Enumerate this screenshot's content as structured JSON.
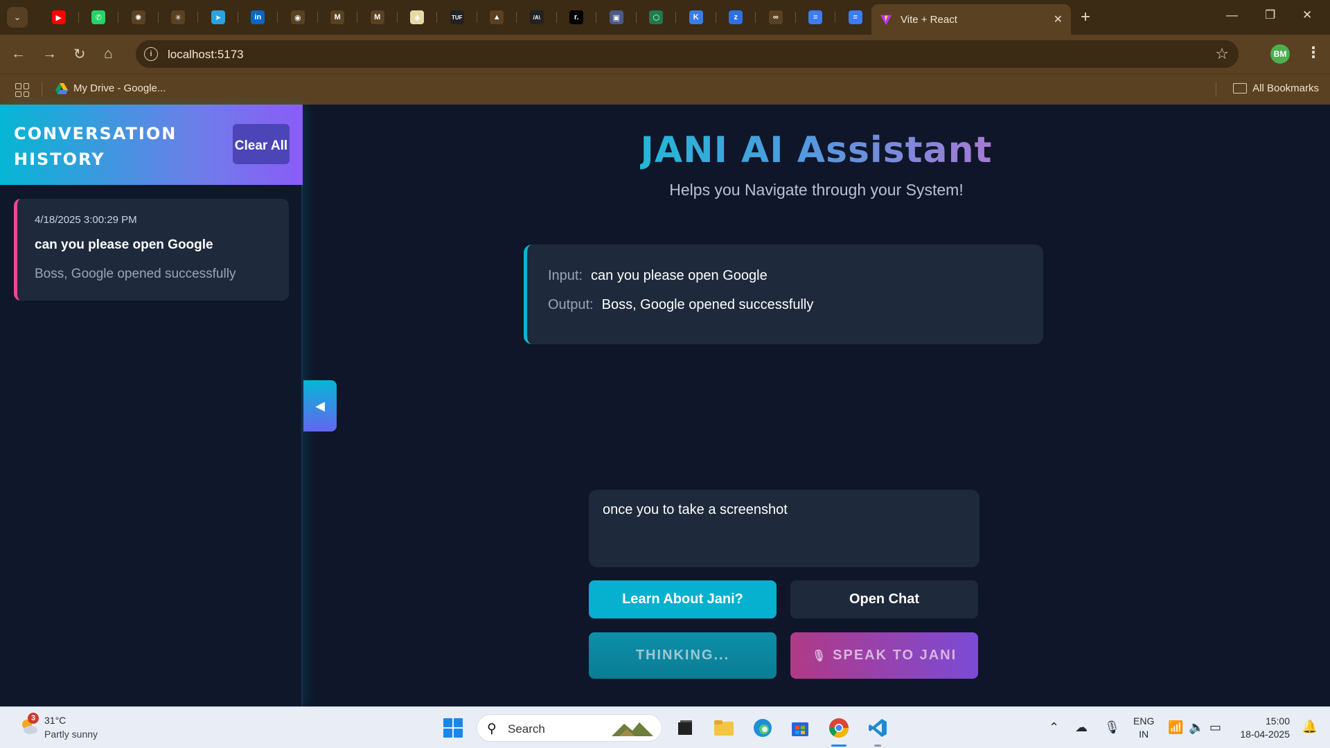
{
  "browser": {
    "active_tab_title": "Vite + React",
    "url": "localhost:5173",
    "profile_initials": "BM",
    "bookmarks": [
      {
        "label": "My Drive - Google..."
      },
      {
        "label": "All Bookmarks"
      }
    ],
    "pinned_tabs": [
      {
        "icon": "youtube-icon",
        "color": "#ff0000",
        "glyph": "▶"
      },
      {
        "icon": "whatsapp-icon",
        "color": "#25d366",
        "glyph": "✆"
      },
      {
        "icon": "chatgpt-icon",
        "color": "#5a4121",
        "glyph": "✺"
      },
      {
        "icon": "claude-icon",
        "color": "#5a4121",
        "glyph": "✳"
      },
      {
        "icon": "telegram-icon",
        "color": "#2aa3df",
        "glyph": "➤"
      },
      {
        "icon": "linkedin-icon",
        "color": "#0a66c2",
        "glyph": "in"
      },
      {
        "icon": "github-icon",
        "color": "#5a4121",
        "glyph": "◉"
      },
      {
        "icon": "gmail-icon",
        "color": "#5a4121",
        "glyph": "M"
      },
      {
        "icon": "gmail-icon",
        "color": "#5a4121",
        "glyph": "M"
      },
      {
        "icon": "college-icon",
        "color": "#e7d9a6",
        "glyph": "◈"
      },
      {
        "icon": "tuf-icon",
        "color": "#222222",
        "glyph": "TUF"
      },
      {
        "icon": "rocket-icon",
        "color": "#5a4121",
        "glyph": "▲"
      },
      {
        "icon": "dev-icon",
        "color": "#222222",
        "glyph": "/A\\"
      },
      {
        "icon": "replit-icon",
        "color": "#000000",
        "glyph": "r."
      },
      {
        "icon": "photos-icon",
        "color": "#4a5a8a",
        "glyph": "▣"
      },
      {
        "icon": "perplexity-icon",
        "color": "#1f7a4d",
        "glyph": "⬡"
      },
      {
        "icon": "kotlin-icon",
        "color": "#3b7de8",
        "glyph": "K"
      },
      {
        "icon": "zbook-icon",
        "color": "#2f6fe4",
        "glyph": "z"
      },
      {
        "icon": "infinity-icon",
        "color": "#5a4121",
        "glyph": "∞"
      },
      {
        "icon": "docs-icon",
        "color": "#3d7cf2",
        "glyph": "≡"
      },
      {
        "icon": "docs-icon",
        "color": "#3d7cf2",
        "glyph": "≡"
      }
    ]
  },
  "sidebar": {
    "title": "CONVERSATION HISTORY",
    "clear_label": "Clear All",
    "history": [
      {
        "timestamp": "4/18/2025 3:00:29 PM",
        "question": "can you please open Google",
        "answer": "Boss, Google opened successfully"
      }
    ]
  },
  "main": {
    "title": "JANI AI Assistant",
    "subtitle": "Helps you Navigate through your System!",
    "io": {
      "input_label": "Input:",
      "input_value": "can you please open Google",
      "output_label": "Output:",
      "output_value": "Boss, Google opened successfully"
    },
    "prompt_value": "once you to take a screenshot",
    "buttons": {
      "learn": "Learn About Jani?",
      "chat": "Open Chat",
      "thinking": "THINKING...",
      "speak": "SPEAK TO JANI"
    }
  },
  "taskbar": {
    "weather_temp": "31°C",
    "weather_desc": "Partly sunny",
    "weather_badge": "3",
    "search_label": "Search",
    "lang_line1": "ENG",
    "lang_line2": "IN",
    "time": "15:00",
    "date": "18-04-2025"
  }
}
